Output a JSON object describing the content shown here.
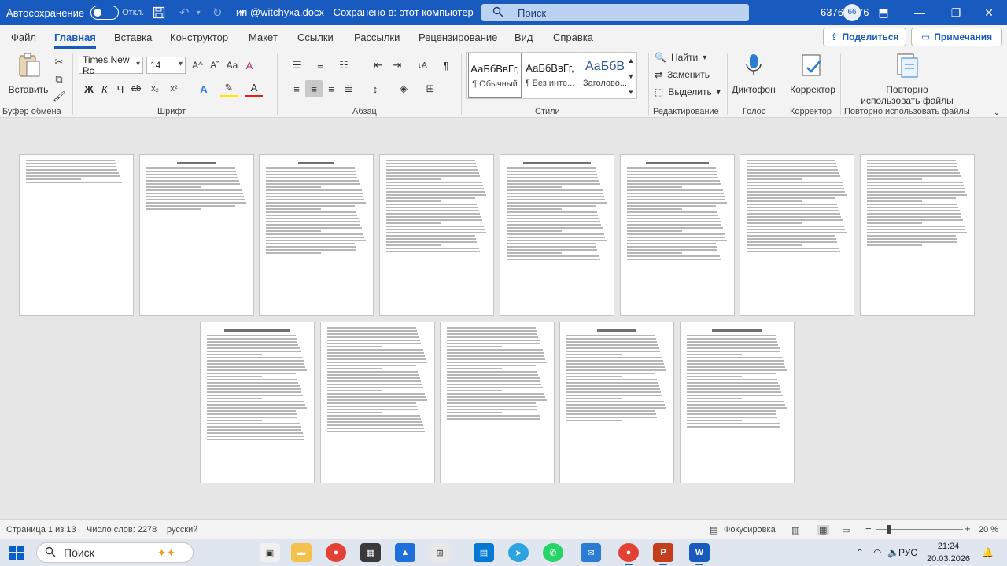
{
  "titlebar": {
    "autosave_label": "Автосохранение",
    "autosave_state": "Откл.",
    "doc_title": "ип @witchyxa.docx  -  Сохранено в: этот компьютер",
    "search_placeholder": "Поиск",
    "user": "6376 6376",
    "avatar_initials": "66",
    "minimize": "—",
    "restore": "❐",
    "close": "✕",
    "ribbon_display_icon": "⬒"
  },
  "ribbon_tabs": [
    "Файл",
    "Главная",
    "Вставка",
    "Конструктор",
    "Макет",
    "Ссылки",
    "Рассылки",
    "Рецензирование",
    "Вид",
    "Справка"
  ],
  "share_label": "Поделиться",
  "notes_label": "Примечания",
  "ribbon": {
    "paste_label": "Вставить",
    "font_name": "Times New Rc",
    "font_size": "14",
    "styles": [
      {
        "sample": "АаБбВвГг,",
        "name": "¶ Обычный"
      },
      {
        "sample": "АаБбВвГг,",
        "name": "¶ Без инте..."
      },
      {
        "sample": "АаБбВ",
        "name": "Заголово..."
      }
    ],
    "find_label": "Найти",
    "replace_label": "Заменить",
    "select_label": "Выделить",
    "dictation_label": "Диктофон",
    "editor_label": "Корректор",
    "reuse_label_1": "Повторно",
    "reuse_label_2": "использовать файлы",
    "groups": [
      "Буфер обмена",
      "Шрифт",
      "Абзац",
      "Стили",
      "Редактирование",
      "Голос",
      "Корректор",
      "Повторно использовать файлы"
    ],
    "formatting": {
      "bold": "Ж",
      "italic": "К",
      "underline": "Ч",
      "strike": "ab",
      "subscript": "x₂",
      "superscript": "x²",
      "grow": "A^",
      "shrink": "Aˇ",
      "case": "Aa",
      "clear": "A",
      "text_effects": "A",
      "highlight": "✎",
      "font_color": "A",
      "paragraph_mark": "¶",
      "sort": "↓A"
    }
  },
  "statusbar": {
    "page": "Страница 1 из 13",
    "words": "Число слов: 2278",
    "language": "русский",
    "focus": "Фокусировка",
    "zoom": "20 %",
    "zoom_minus": "−",
    "zoom_plus": "+"
  },
  "taskbar": {
    "search_placeholder": "Поиск",
    "lang": "РУС",
    "time": "21:24",
    "date": "20.03.2026"
  },
  "pages": [
    {
      "title": "",
      "lines": 8
    },
    {
      "title": "Оглавление",
      "lines": 14
    },
    {
      "title": "Введение",
      "lines": 28
    },
    {
      "title": "",
      "lines": 30
    },
    {
      "title": "Глава 1. Теоретическая часть",
      "lines": 30
    },
    {
      "title": "1.2. Ресурсы для развития",
      "lines": 30
    },
    {
      "title": "",
      "lines": 30
    },
    {
      "title": "",
      "lines": 28
    },
    {
      "title": "Глава 2. Практическая часть",
      "lines": 34
    },
    {
      "title": "",
      "lines": 34
    },
    {
      "title": "",
      "lines": 30
    },
    {
      "title": "Заключение",
      "lines": 28
    },
    {
      "title": "Список литературы",
      "lines": 30
    }
  ]
}
